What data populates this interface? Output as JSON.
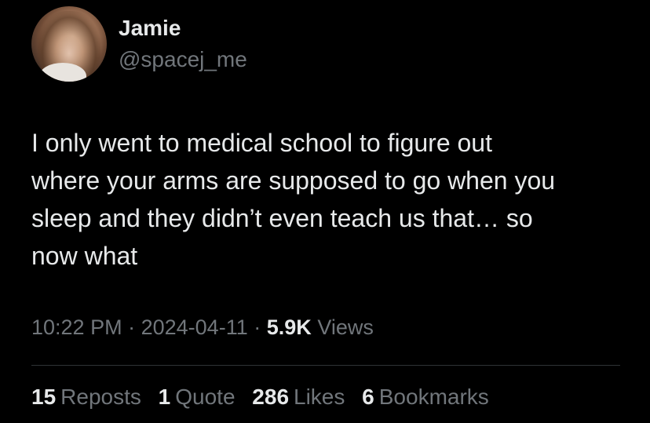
{
  "author": {
    "display_name": "Jamie",
    "handle": "@spacej_me"
  },
  "tweet": {
    "text": "I only went to medical school to figure out\nwhere your arms are supposed to go when you\nsleep and they didn’t even teach us that… so\nnow what"
  },
  "meta": {
    "time": "10:22 PM",
    "separator": "·",
    "date": "2024-04-11",
    "views_count": "5.9K",
    "views_label": "Views"
  },
  "stats": {
    "reposts": {
      "count": "15",
      "label": "Reposts"
    },
    "quotes": {
      "count": "1",
      "label": "Quote"
    },
    "likes": {
      "count": "286",
      "label": "Likes"
    },
    "bookmarks": {
      "count": "6",
      "label": "Bookmarks"
    }
  },
  "colors": {
    "background": "#000000",
    "primary_text": "#e7e9ea",
    "secondary_text": "#71767b",
    "divider": "#2f3336"
  }
}
